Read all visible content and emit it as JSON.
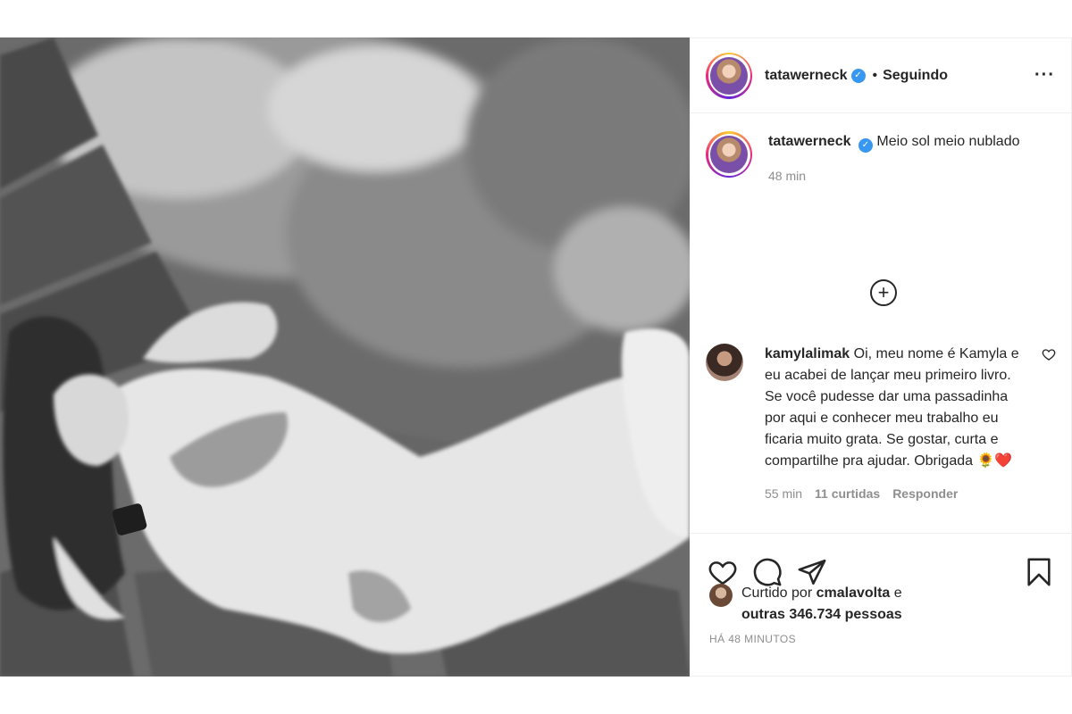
{
  "post_author": {
    "username": "tatawerneck",
    "verified": true,
    "follow_status": "Seguindo",
    "dot": "•"
  },
  "caption": {
    "username": "tatawerneck",
    "text": "Meio sol meio nublado",
    "time": "48 min"
  },
  "load_more": {
    "icon": "plus-circle-icon"
  },
  "comment": {
    "username": "kamylalimak",
    "text": "Oi, meu nome é Kamyla e eu acabei de lançar meu primeiro livro. Se você pudesse dar uma passadinha por aqui e conhecer meu trabalho eu ficaria muito grata. Se gostar, curta e compartilhe pra ajudar. Obrigada 🌻❤️",
    "time": "55 min",
    "likes": "11 curtidas",
    "reply": "Responder"
  },
  "actions": {
    "like_icon": "heart-icon",
    "comment_icon": "comment-icon",
    "share_icon": "share-icon",
    "save_icon": "bookmark-icon"
  },
  "likes": {
    "prefix": "Curtido por",
    "liker": "cmalavolta",
    "connector": "e",
    "others": "outras 346.734 pessoas"
  },
  "posted_ago": "HÁ 48 MINUTOS",
  "colors": {
    "text": "#262626",
    "muted": "#8e8e8e",
    "verified": "#3897f0",
    "border": "#efefef"
  }
}
